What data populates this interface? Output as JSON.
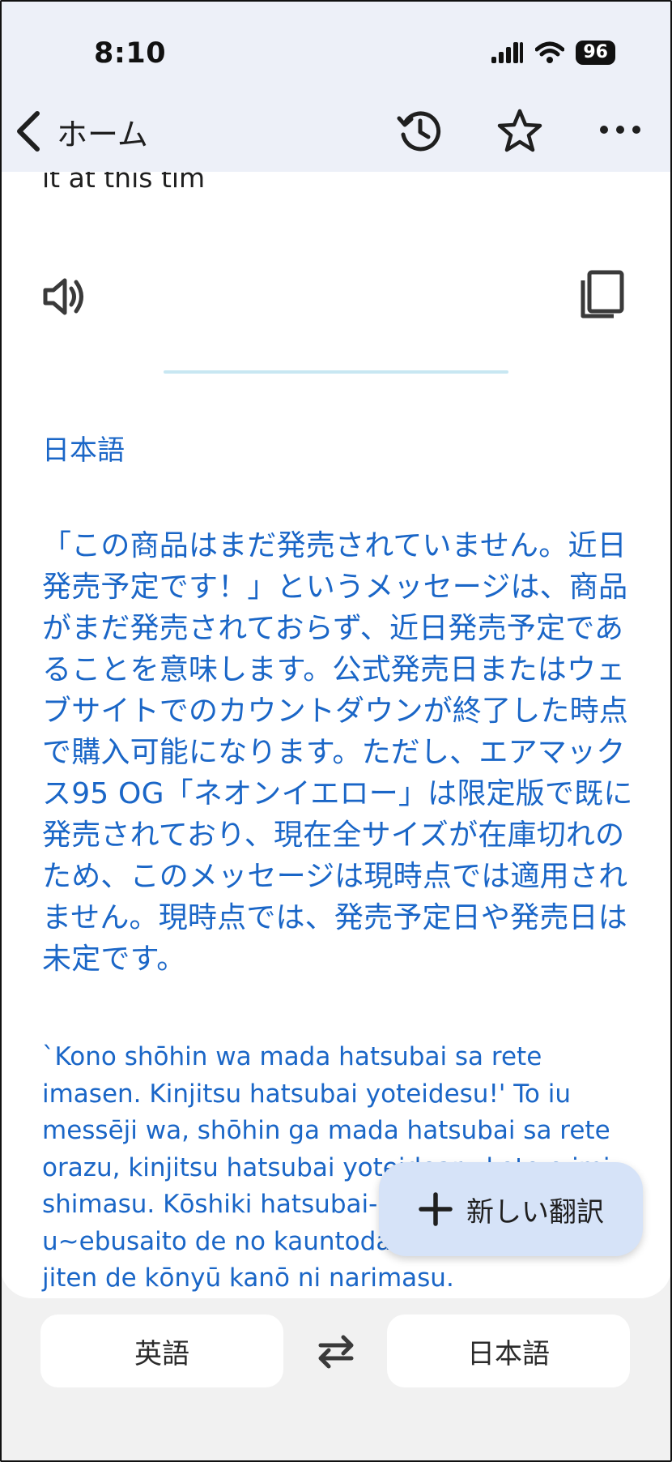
{
  "status": {
    "time": "8:10",
    "battery": "96"
  },
  "toolbar": {
    "back_label": "ホーム",
    "icons": [
      "history-icon",
      "star-icon",
      "more-icon"
    ]
  },
  "source": {
    "clipped_text": "it at this tim"
  },
  "result": {
    "language": "日本語",
    "translation": "「この商品はまだ発売されていません。近日発売予定です！」というメッセージは、商品がまだ発売されておらず、近日発売予定であることを意味します。公式発売日またはウェブサイトでのカウントダウンが終了した時点で購入可能になります。ただし、エアマックス95 OG「ネオンイエロー」は限定版で既に発売されており、現在全サイズが在庫切れのため、このメッセージは現時点では適用されません。現時点では、発売予定日や発売日は未定です。",
    "romanization": "`Kono shōhin wa mada hatsubai sa rete imasen. Kinjitsu hatsubai yoteidesu!' To iu messēji wa, shōhin ga mada hatsubai sa rete orazu, kinjitsu hatsubai yoteidearu koto o imi shimasu. Kōshiki hatsubai-bi matawa u~ebusaito de no kauntodaun ga shūryō shita jiten de kōnyū kanō ni narimasu."
  },
  "fab": {
    "label": "新しい翻訳"
  },
  "languages": {
    "source": "英語",
    "target": "日本語"
  },
  "colors": {
    "accent": "#1a66c7",
    "header_bg": "#edf0f8",
    "fab_bg": "#d6e3f8"
  }
}
